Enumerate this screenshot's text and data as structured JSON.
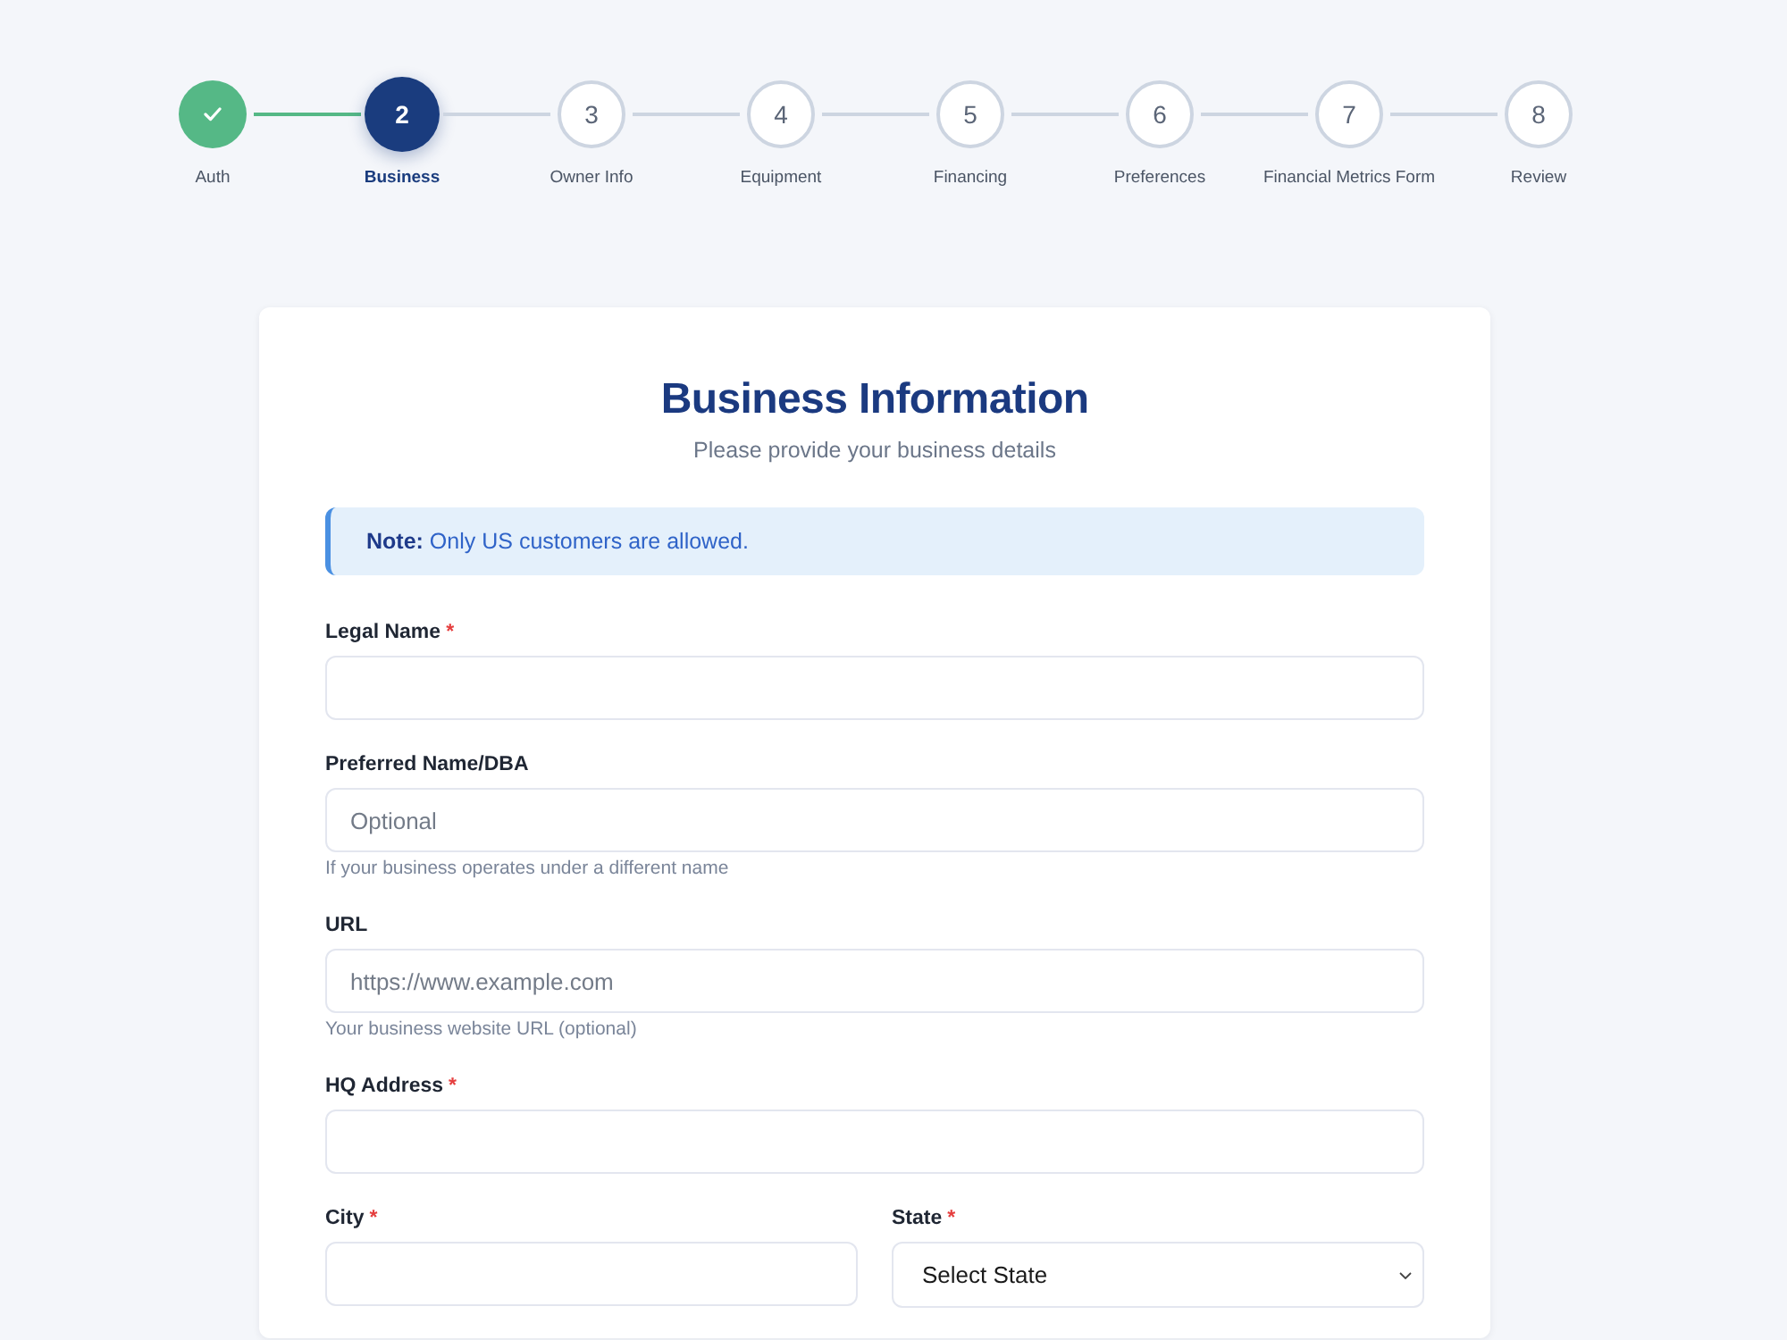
{
  "stepper": {
    "steps": [
      {
        "label": "Auth",
        "completed": true,
        "selected": false
      },
      {
        "number": "2",
        "label": "Business",
        "completed": false,
        "selected": true
      },
      {
        "number": "3",
        "label": "Owner Info",
        "completed": false,
        "selected": false
      },
      {
        "number": "4",
        "label": "Equipment",
        "completed": false,
        "selected": false
      },
      {
        "number": "5",
        "label": "Financing",
        "completed": false,
        "selected": false
      },
      {
        "number": "6",
        "label": "Preferences",
        "completed": false,
        "selected": false
      },
      {
        "number": "7",
        "label": "Financial Metrics Form",
        "completed": false,
        "selected": false
      },
      {
        "number": "8",
        "label": "Review",
        "completed": false,
        "selected": false
      }
    ]
  },
  "form": {
    "title": "Business Information",
    "subtitle": "Please provide your business details",
    "note": "**Note:** Only US customers are allowed.",
    "rows": [
      {
        "fields": [
          {
            "kind": "text",
            "label": "Legal Name",
            "required_mark": "*"
          }
        ]
      },
      {
        "fields": [
          {
            "kind": "text",
            "label": "Preferred Name/DBA",
            "placeholder": "Optional",
            "hint": "If your business operates under a different name"
          }
        ]
      },
      {
        "fields": [
          {
            "kind": "text",
            "label": "URL",
            "placeholder": "https://www.example.com",
            "hint": "Your business website URL (optional)"
          }
        ]
      },
      {
        "fields": [
          {
            "kind": "text",
            "label": "HQ Address",
            "required_mark": "*"
          }
        ]
      },
      {
        "fields": [
          {
            "kind": "text",
            "label": "City",
            "required_mark": "*"
          },
          {
            "kind": "select",
            "label": "State",
            "required_mark": "*",
            "value": "Select State"
          }
        ]
      }
    ]
  }
}
